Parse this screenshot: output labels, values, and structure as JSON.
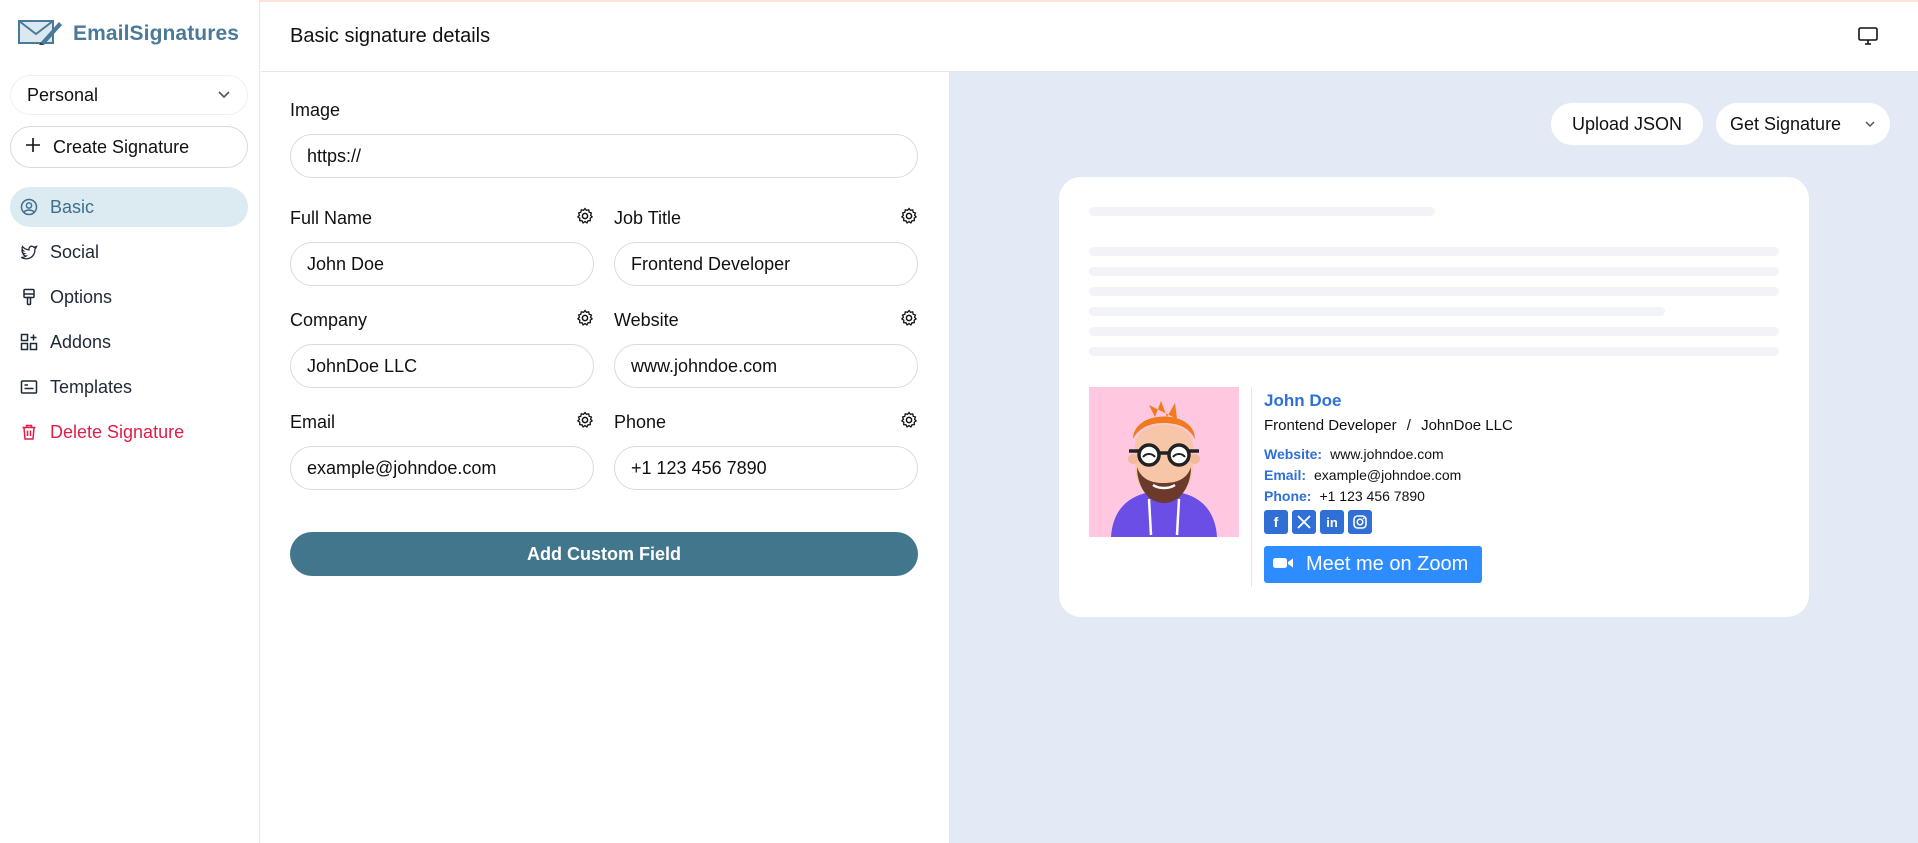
{
  "app": {
    "brand_name": "EmailSignatures"
  },
  "sidebar": {
    "profile_select": "Personal",
    "create_label": "Create Signature",
    "items": [
      {
        "label": "Basic",
        "icon": "user-circle-icon"
      },
      {
        "label": "Social",
        "icon": "twitter-icon"
      },
      {
        "label": "Options",
        "icon": "brush-icon"
      },
      {
        "label": "Addons",
        "icon": "widgets-icon"
      },
      {
        "label": "Templates",
        "icon": "template-icon"
      },
      {
        "label": "Delete Signature",
        "icon": "trash-icon"
      }
    ]
  },
  "header": {
    "title": "Basic signature details"
  },
  "form": {
    "image": {
      "label": "Image",
      "value": "https://"
    },
    "full_name": {
      "label": "Full Name",
      "value": "John Doe"
    },
    "job_title": {
      "label": "Job Title",
      "value": "Frontend Developer"
    },
    "company": {
      "label": "Company",
      "value": "JohnDoe LLC"
    },
    "website": {
      "label": "Website",
      "value": "www.johndoe.com"
    },
    "email": {
      "label": "Email",
      "value": "example@johndoe.com"
    },
    "phone": {
      "label": "Phone",
      "value": "+1 123 456 7890"
    },
    "add_custom_label": "Add Custom Field"
  },
  "preview": {
    "upload_label": "Upload JSON",
    "get_label": "Get Signature",
    "signature": {
      "name": "John Doe",
      "job_title": "Frontend Developer",
      "separator": "/",
      "company": "JohnDoe LLC",
      "website_label": "Website:",
      "website": "www.johndoe.com",
      "email_label": "Email:",
      "email": "example@johndoe.com",
      "phone_label": "Phone:",
      "phone": "+1 123 456 7890",
      "socials": [
        "facebook-icon",
        "x-icon",
        "linkedin-icon",
        "instagram-icon"
      ],
      "zoom_label": "Meet me on Zoom"
    }
  },
  "colors": {
    "brand": "#4b7a99",
    "accent": "#42768c",
    "link": "#2f6fd6",
    "danger": "#e11d48",
    "preview_bg": "#e3eaf5",
    "zoom": "#2d8cff"
  }
}
